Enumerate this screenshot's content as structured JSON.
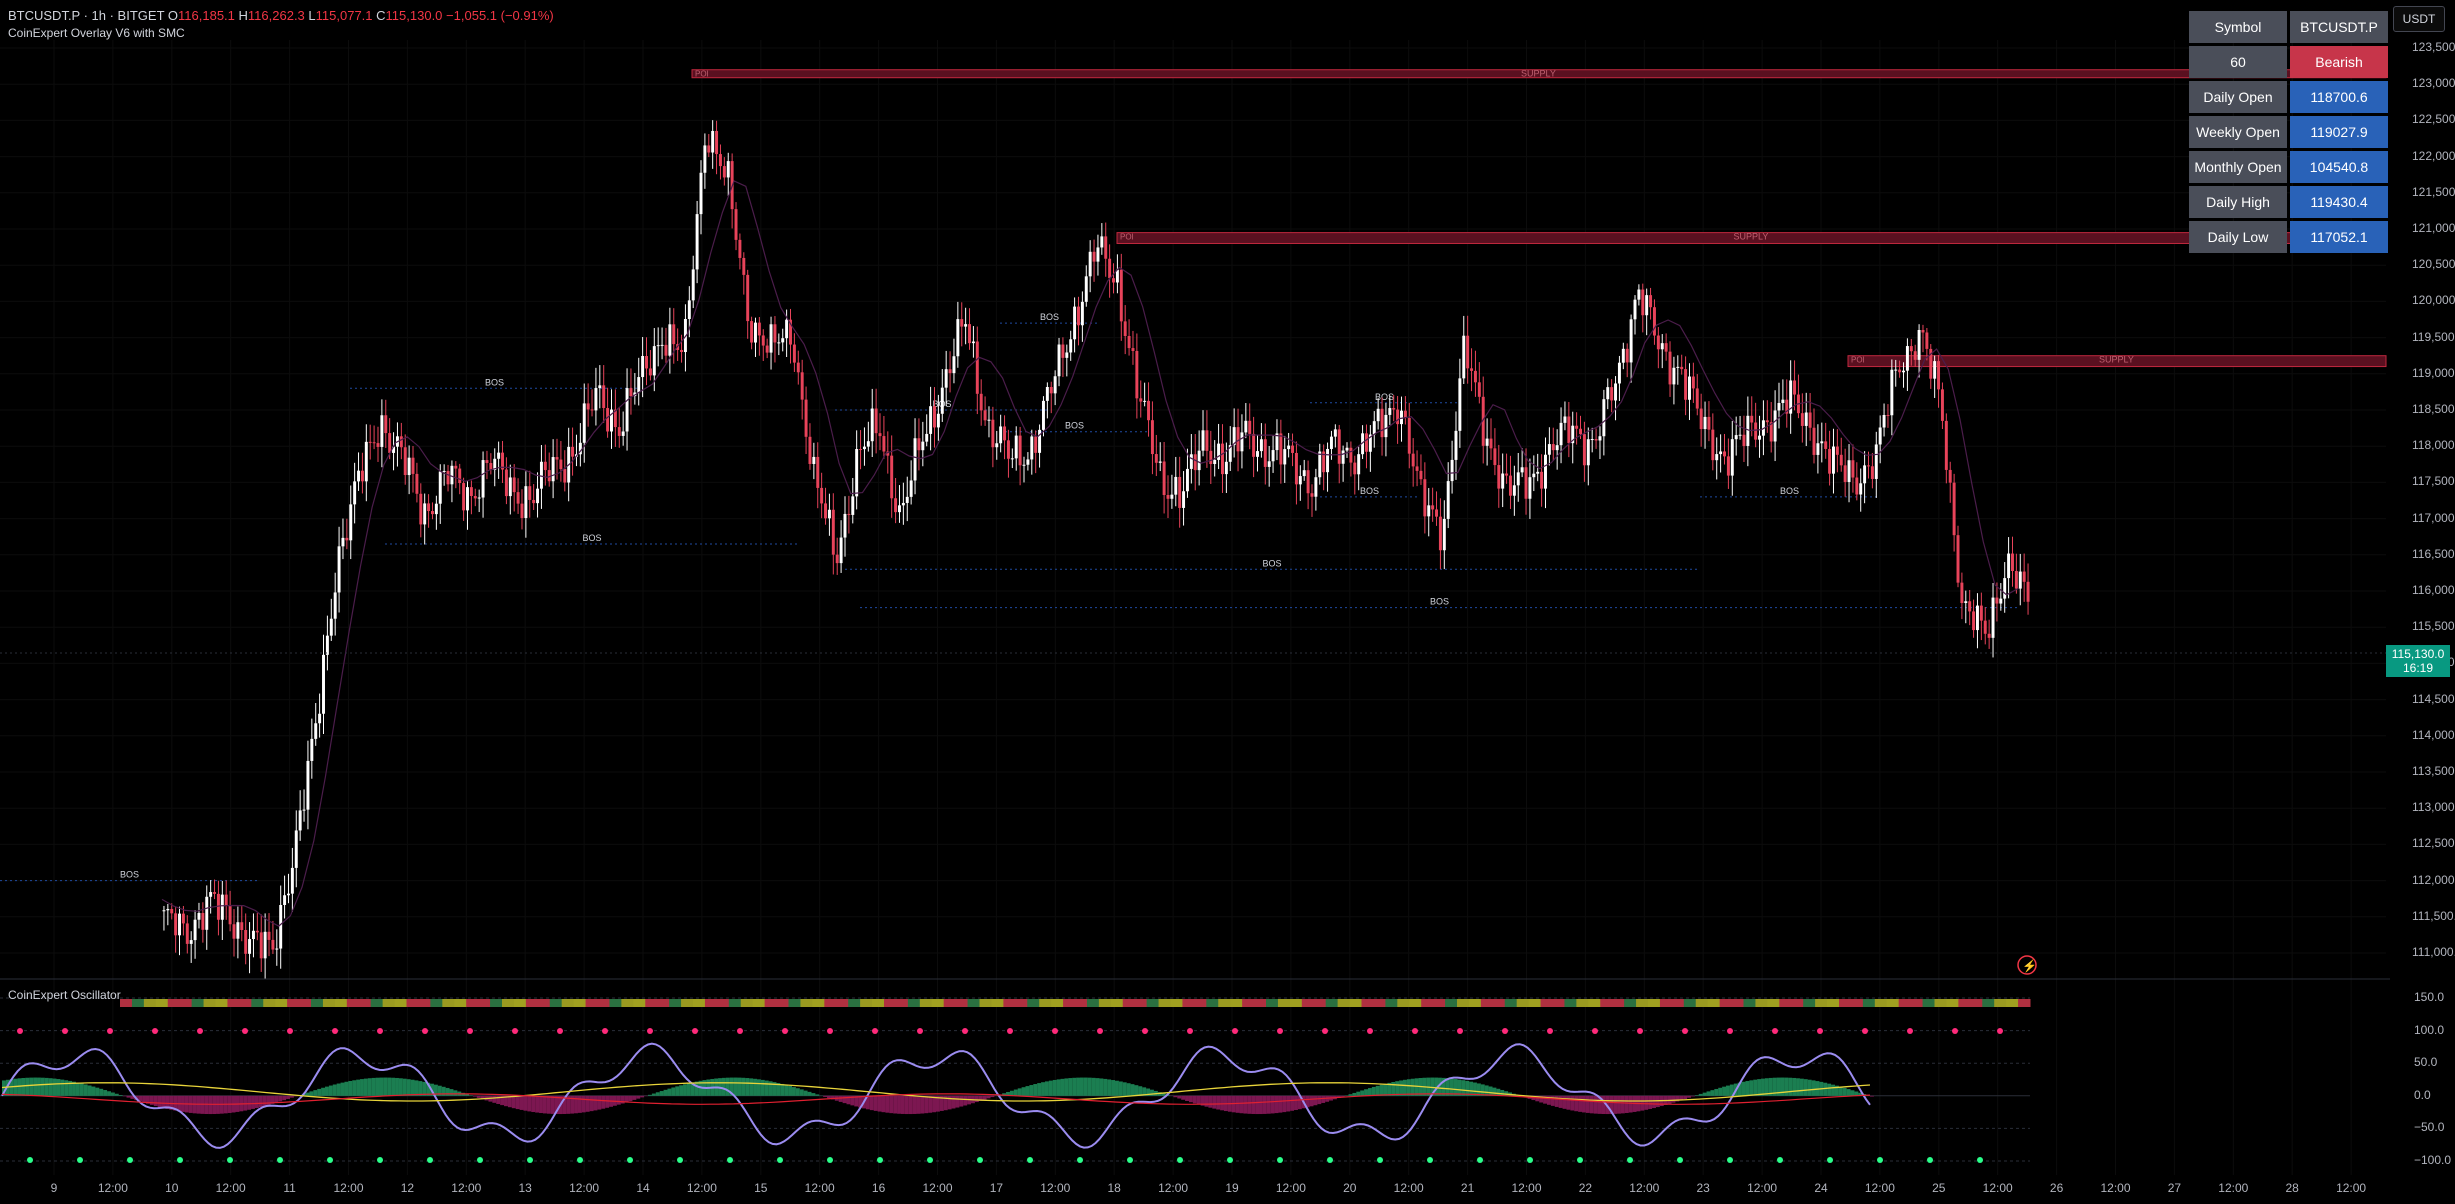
{
  "header": {
    "symbol": "BTCUSDT.P · 1h · BITGET",
    "open_label": "O",
    "open": "116,185.1",
    "high_label": "H",
    "high": "116,262.3",
    "low_label": "L",
    "low": "115,077.1",
    "close_label": "C",
    "close": "115,130.0",
    "change": "−1,055.1 (−0.91%)"
  },
  "indicators": {
    "overlay": "CoinExpert Overlay V6 with SMC",
    "oscillator": "CoinExpert Oscillator"
  },
  "currency_button": "USDT",
  "info_table": [
    {
      "key": "Symbol",
      "value": "BTCUSDT.P",
      "style": "sym"
    },
    {
      "key": "60",
      "value": "Bearish",
      "style": "bear"
    },
    {
      "key": "Daily Open",
      "value": "118700.6",
      "style": "v"
    },
    {
      "key": "Weekly Open",
      "value": "119027.9",
      "style": "v"
    },
    {
      "key": "Monthly Open",
      "value": "104540.8",
      "style": "v"
    },
    {
      "key": "Daily High",
      "value": "119430.4",
      "style": "v"
    },
    {
      "key": "Daily Low",
      "value": "117052.1",
      "style": "v"
    }
  ],
  "price_axis": [
    "123,500.0",
    "123,000.0",
    "122,500.0",
    "122,000.0",
    "121,500.0",
    "121,000.0",
    "120,500.0",
    "120,000.0",
    "119,500.0",
    "119,000.0",
    "118,500.0",
    "118,000.0",
    "117,500.0",
    "117,000.0",
    "116,500.0",
    "116,000.0",
    "115,500.0",
    "115,000.0",
    "114,500.0",
    "114,000.0",
    "113,500.0",
    "113,000.0",
    "112,500.0",
    "112,000.0",
    "111,500.0",
    "111,000.0"
  ],
  "current_price": {
    "price": "115,130.0",
    "countdown": "16:19",
    "color": "#089981"
  },
  "osc_axis": [
    "150.0",
    "100.0",
    "50.0",
    "0.0",
    "−50.0",
    "−100.0"
  ],
  "time_axis": [
    "9",
    "12:00",
    "10",
    "12:00",
    "11",
    "12:00",
    "12",
    "12:00",
    "13",
    "12:00",
    "14",
    "12:00",
    "15",
    "12:00",
    "16",
    "12:00",
    "17",
    "12:00",
    "18",
    "12:00",
    "19",
    "12:00",
    "20",
    "12:00",
    "21",
    "12:00",
    "22",
    "12:00",
    "23",
    "12:00",
    "24",
    "12:00",
    "25",
    "12:00",
    "26",
    "12:00",
    "27",
    "12:00",
    "28",
    "12:00"
  ],
  "annotations": {
    "supply_label": "SUPPLY",
    "poi_label": "POI",
    "bos_label": "BOS"
  },
  "chart_data": {
    "type": "candlestick",
    "symbol": "BTCUSDT.P",
    "interval": "1h",
    "ylim": [
      110700,
      123800
    ],
    "close_path": [
      111500,
      111200,
      111800,
      111400,
      111300,
      110900,
      112500,
      114000,
      116500,
      117500,
      118400,
      117800,
      117100,
      117600,
      117300,
      117800,
      117400,
      117300,
      117700,
      118000,
      118700,
      118300,
      118900,
      119600,
      119200,
      122500,
      121600,
      119800,
      119300,
      119600,
      117500,
      116500,
      117800,
      118300,
      117000,
      118100,
      118900,
      119700,
      118300,
      117800,
      118000,
      118800,
      119800,
      120700,
      120300,
      118600,
      117600,
      117300,
      118100,
      117800,
      118200,
      117900,
      117800,
      117500,
      118000,
      117900,
      118200,
      118700,
      117200,
      116900,
      119300,
      118200,
      117300,
      117600,
      117900,
      118300,
      118000,
      118900,
      120200,
      119300,
      119100,
      118200,
      117900,
      118100,
      118400,
      118600,
      118300,
      117700,
      117600,
      117800,
      119200,
      119500,
      118600,
      115700,
      115400,
      116400,
      115800
    ],
    "supply_zones": [
      {
        "label": "SUPPLY",
        "low": 123100,
        "high": 123200
      },
      {
        "label": "SUPPLY",
        "low": 120800,
        "high": 120950
      },
      {
        "label": "SUPPLY",
        "low": 119100,
        "high": 119250
      }
    ],
    "bos_levels": [
      118800,
      116650,
      118500,
      119700,
      118200,
      116300,
      117300,
      118600,
      115770,
      117300,
      112000
    ],
    "current_price": 115130.0,
    "oscillator": {
      "ylim": [
        -110,
        160
      ],
      "levels": [
        150,
        100,
        50,
        0,
        -50,
        -100
      ]
    }
  }
}
